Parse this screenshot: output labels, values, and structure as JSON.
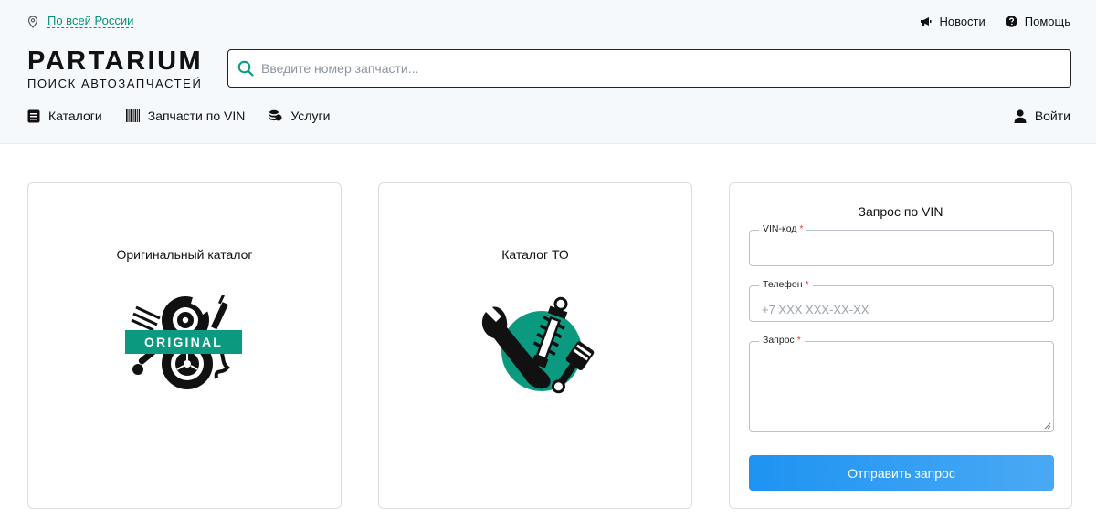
{
  "topbar": {
    "region": "По всей России",
    "news": "Новости",
    "help": "Помощь"
  },
  "logo": {
    "main": "PARTARIUM",
    "sub": "ПОИСК АВТОЗАПЧАСТЕЙ"
  },
  "search": {
    "placeholder": "Введите номер запчасти..."
  },
  "nav": {
    "catalogs": "Каталоги",
    "vin_parts": "Запчасти по VIN",
    "services": "Услуги",
    "login": "Войти"
  },
  "cards": {
    "original": {
      "title": "Оригинальный каталог",
      "badge": "ORIGINAL"
    },
    "to": {
      "title": "Каталог ТО"
    }
  },
  "vin_form": {
    "title": "Запрос по VIN",
    "vin_label": "VIN-код",
    "phone_label": "Телефон",
    "phone_placeholder": "+7 XXX XXX-XX-XX",
    "query_label": "Запрос",
    "required_mark": "*",
    "submit": "Отправить запрос"
  },
  "colors": {
    "accent_green": "#0b9a80",
    "submit_blue": "#2196f3",
    "required_red": "#e53935"
  }
}
